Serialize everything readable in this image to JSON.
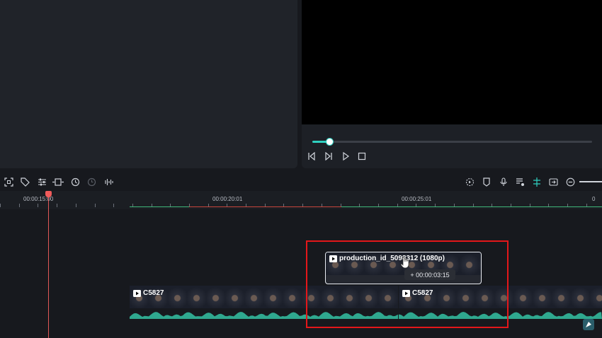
{
  "player": {
    "progress": 0.06,
    "controls": [
      "prev-frame-icon",
      "next-frame-icon",
      "play-icon",
      "stop-icon"
    ]
  },
  "toolbar": {
    "left_tools": [
      "crop-icon",
      "tag-icon",
      "adjust-icon",
      "fit-icon",
      "rotate-icon",
      "speed-icon",
      "audio-split-icon"
    ],
    "right_tools": [
      "render-icon",
      "marker-icon",
      "mic-icon",
      "voiceover-icon",
      "snap-icon",
      "replace-icon",
      "zoom-out-icon"
    ]
  },
  "ruler": {
    "labels": [
      "00:00:15:00",
      "00:00:20:01",
      "00:00:25:01",
      "0"
    ]
  },
  "timeline": {
    "main_clip_label": "C5827",
    "second_clip_label": "C5827",
    "ghost_clip_label": "production_id_5098312 (1080p)",
    "drag_offset": "+ 00:00:03:15"
  },
  "colors": {
    "accent": "#2fd0c0",
    "playhead": "#ef5b5b",
    "highlight": "#e4171a",
    "waveform": "#2fa88f"
  }
}
